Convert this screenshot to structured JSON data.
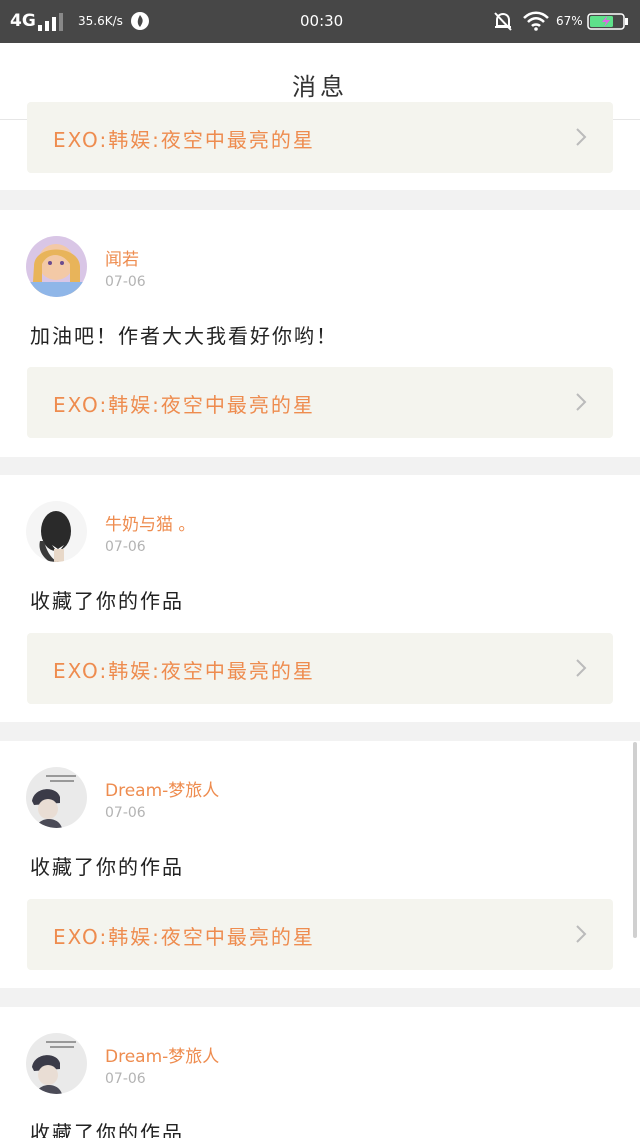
{
  "status_bar": {
    "network": "4G",
    "speed": "35.6K/s",
    "time": "00:30",
    "battery": "67%"
  },
  "nav": {
    "title": "消息"
  },
  "items": [
    {
      "work_title": "EXO:韩娱:夜空中最亮的星"
    },
    {
      "name": "闻若",
      "date": "07-06",
      "message": "加油吧！作者大大我看好你哟！",
      "work_title": "EXO:韩娱:夜空中最亮的星"
    },
    {
      "name": "牛奶与猫 。",
      "date": "07-06",
      "message": "收藏了你的作品",
      "work_title": "EXO:韩娱:夜空中最亮的星"
    },
    {
      "name": "Dream-梦旅人",
      "date": "07-06",
      "message": "收藏了你的作品",
      "work_title": "EXO:韩娱:夜空中最亮的星"
    },
    {
      "name": "Dream-梦旅人",
      "date": "07-06",
      "message": "收藏了你的作品"
    }
  ],
  "icons": {
    "chevron": "chevron-right-icon",
    "signal": "signal-icon",
    "wifi": "wifi-icon",
    "battery": "battery-charging-icon",
    "bell": "bell-off-icon"
  },
  "colors": {
    "accent": "#ee8c4f",
    "work_bg": "#f4f4ee",
    "status_bar": "#474747"
  }
}
